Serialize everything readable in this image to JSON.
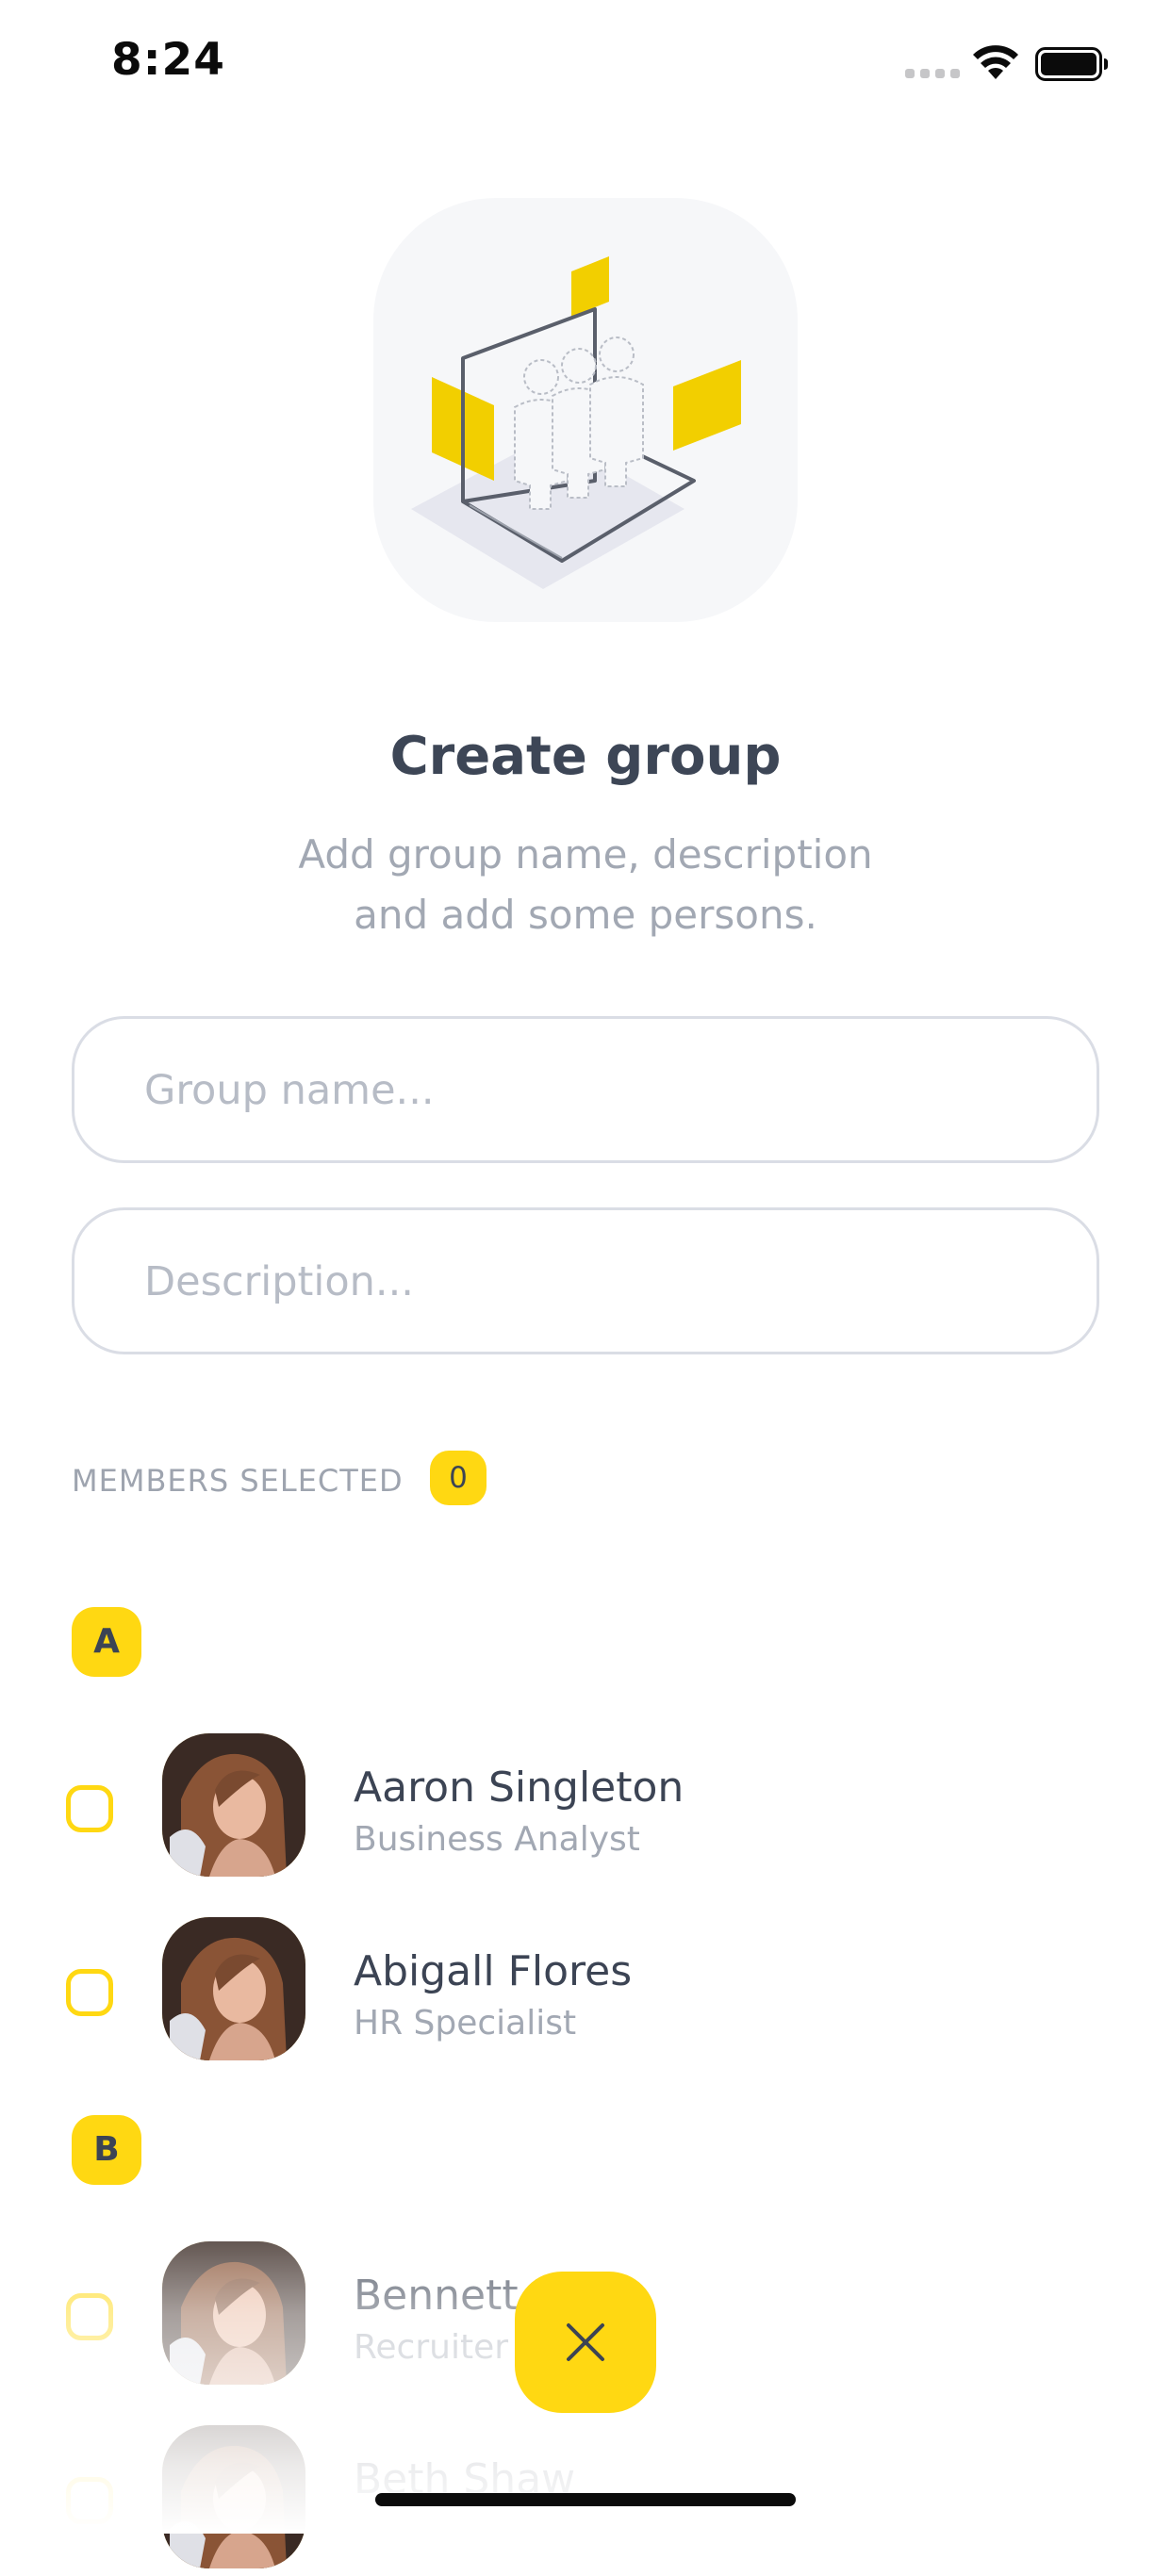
{
  "status_bar": {
    "time": "8:24",
    "signal_icon": "cellular-signal-icon",
    "wifi_icon": "wifi-icon",
    "battery_icon": "battery-icon"
  },
  "hero": {
    "illustration_icon": "create-group-illustration",
    "title": "Create group",
    "subtitle_line1": "Add group name, description",
    "subtitle_line2": "and add some persons."
  },
  "form": {
    "group_name_placeholder": "Group name...",
    "group_name_value": "",
    "description_placeholder": "Description...",
    "description_value": ""
  },
  "members": {
    "label": "MEMBERS SELECTED",
    "count": "0"
  },
  "sections": [
    {
      "letter": "A",
      "people": [
        {
          "name": "Aaron Singleton",
          "role": "Business Analyst",
          "checked": false
        },
        {
          "name": "Abigall Flores",
          "role": "HR Specialist",
          "checked": false
        }
      ]
    },
    {
      "letter": "B",
      "people": [
        {
          "name": "Bennett F",
          "role": "Recruiter",
          "checked": false
        },
        {
          "name": "Beth Shaw",
          "role": "",
          "checked": false
        }
      ]
    }
  ],
  "fab": {
    "icon": "close-icon"
  },
  "colors": {
    "accent": "#ffd812",
    "text_primary": "#3c4454",
    "text_secondary": "#a2a8b3",
    "border": "#dadde5"
  }
}
